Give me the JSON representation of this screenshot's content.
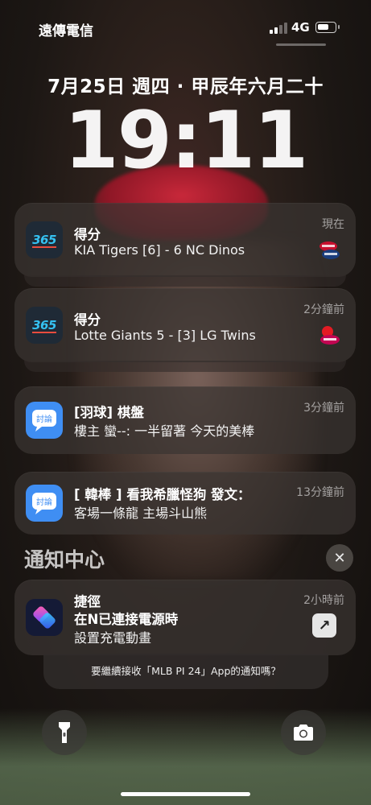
{
  "status": {
    "carrier": "遠傳電信",
    "network": "4G"
  },
  "lock": {
    "date": "7月25日 週四 · 甲辰年六月二十",
    "time": "19:11"
  },
  "notifications": [
    {
      "app_icon": "365-scores-icon",
      "title": "得分",
      "body": "KIA Tigers [6] - 6 NC Dinos",
      "time": "現在",
      "logo": "kia-tigers-nc-dinos-logo"
    },
    {
      "app_icon": "365-scores-icon",
      "title": "得分",
      "body": "Lotte Giants 5 - [3] LG Twins",
      "time": "2分鐘前",
      "logo": "lotte-giants-lg-twins-logo"
    },
    {
      "app_icon": "ptt-app-icon",
      "title": "[羽球] 棋盤",
      "body": "樓主 蠻--: 一半留著 今天的美棒",
      "time": "3分鐘前"
    },
    {
      "app_icon": "ptt-app-icon",
      "title": "[ 韓棒 ] 看我希臘怪狗 發文：",
      "body": "客場一條龍 主場斗山熊",
      "time": "13分鐘前"
    }
  ],
  "notification_center": {
    "title": "通知中心",
    "close_glyph": "✕",
    "item": {
      "app_icon": "shortcuts-icon",
      "title": "捷徑",
      "line1": "在N已連接電源時",
      "line2": "設置充電動畫",
      "time": "2小時前",
      "action_glyph": "↗"
    },
    "prompt": "要繼續接收「MLB PI 24」App的通知嗎？"
  },
  "icons": {
    "365_text": "365",
    "ptt_text": "討論"
  },
  "colors": {
    "accent_365": "#35c1f1",
    "ptt_blue": "#3f8ef3"
  }
}
